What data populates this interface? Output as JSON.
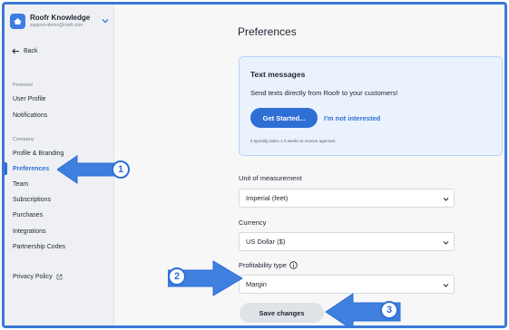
{
  "workspace": {
    "name": "Roofr Knowledge",
    "email": "support+demo@roofr.com"
  },
  "nav": {
    "back_label": "Back",
    "personal_label": "Personal",
    "personal_items": [
      "User Profile",
      "Notifications"
    ],
    "company_label": "Company",
    "company_items": [
      "Profile & Branding",
      "Preferences",
      "Team",
      "Subscriptions",
      "Purchases",
      "Integrations",
      "Partnership Codes"
    ],
    "active_item": "Preferences",
    "privacy_label": "Privacy Policy"
  },
  "page": {
    "title": "Preferences"
  },
  "text_messages_card": {
    "title": "Text messages",
    "description": "Send texts directly from Roofr to your customers!",
    "primary_button": "Get Started...",
    "secondary_link": "I'm not interested",
    "note": "It typically takes 1-2 weeks to receive approval."
  },
  "fields": {
    "unit_label": "Unit of measurement",
    "unit_value": "Imperial (feet)",
    "currency_label": "Currency",
    "currency_value": "US Dollar ($)",
    "profitability_label": "Profitability type",
    "profitability_value": "Margin"
  },
  "save_button": "Save changes",
  "annotations": {
    "badge_1": "1",
    "badge_2": "2",
    "badge_3": "3",
    "color": "#2e6fd6"
  },
  "icons": {
    "workspace_logo": "roof-icon",
    "workspace_switcher": "chevron-down-icon",
    "back": "arrow-left-icon",
    "privacy": "external-link-icon",
    "profitability_info": "info-icon",
    "select_chevron": "chevron-down-icon"
  },
  "colors": {
    "accent": "#2e6fd6",
    "card_bg": "#eaf2fd",
    "sidebar_bg": "#eef0f3",
    "frame_border": "#3a78d8"
  }
}
